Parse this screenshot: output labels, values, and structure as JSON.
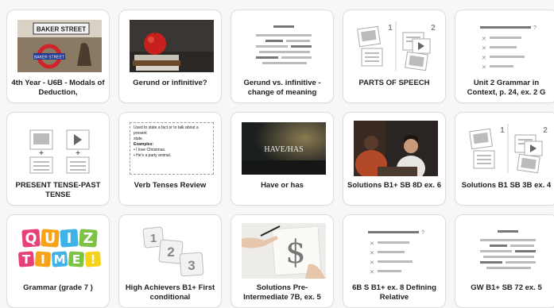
{
  "cards": [
    {
      "title": "4th Year - U6B - Modals of Deduction,",
      "thumb_text": "BAKER STREET",
      "icon": "photo-baker-street"
    },
    {
      "title": "Gerund or infinitive?",
      "icon": "photo-apple-on-books"
    },
    {
      "title": "Gerund vs. infinitive - change of meaning",
      "icon": "lines-placeholder-icon"
    },
    {
      "title": "PARTS OF SPEECH",
      "icon": "match-up-placeholder-icon",
      "thumb_nums": [
        "1",
        "2"
      ]
    },
    {
      "title": "Unit 2 Grammar in Context, p. 24, ex. 2 G",
      "icon": "quiz-placeholder-icon",
      "thumb_mark": "?"
    },
    {
      "title": "PRESENT TENSE-PAST TENSE",
      "icon": "group-sort-placeholder-icon"
    },
    {
      "title": "Verb Tenses Review",
      "icon": "text-card-thumbnail",
      "thumb_lines": [
        "Used to state a fact or to talk about a present",
        "state.",
        "Examples:",
        "I love Christmas.",
        "He's a party animal."
      ]
    },
    {
      "title": "Have or has",
      "thumb_text": "HAVE/HAS",
      "icon": "photo-have-has"
    },
    {
      "title": "Solutions B1+ SB 8D ex. 6",
      "icon": "photo-people-talking"
    },
    {
      "title": "Solutions B1 SB 3B ex. 4",
      "icon": "match-up-placeholder-icon",
      "thumb_nums": [
        "1",
        "2"
      ]
    },
    {
      "title": "Grammar (grade 7 )",
      "thumb_letters": [
        "Q",
        "U",
        "I",
        "Z",
        "T",
        "I",
        "M",
        "E",
        "!"
      ],
      "icon": "quiz-time-logo"
    },
    {
      "title": "High Achievers B1+ First conditional",
      "thumb_nums": [
        "1",
        "2",
        "3"
      ],
      "icon": "numbered-tiles-icon"
    },
    {
      "title": "Solutions Pre-Intermediate 7B, ex. 5",
      "thumb_text": "$",
      "icon": "photo-hand-drawing-dollar"
    },
    {
      "title": "6B S B1+ ex. 8 Defining Relative",
      "icon": "quiz-placeholder-icon",
      "thumb_mark": "?"
    },
    {
      "title": "GW B1+ SB 72 ex. 5",
      "icon": "lines-placeholder-icon"
    }
  ],
  "colors": {
    "card_border": "#dedede",
    "placeholder_dark": "#777777",
    "placeholder_light": "#bbbbbb",
    "quiz_colors": [
      "#e8407a",
      "#f6a31a",
      "#3fb3e8",
      "#7dc242",
      "#e8407a",
      "#f6a31a",
      "#3fb3e8",
      "#7dc242",
      "#f6d21a"
    ]
  }
}
